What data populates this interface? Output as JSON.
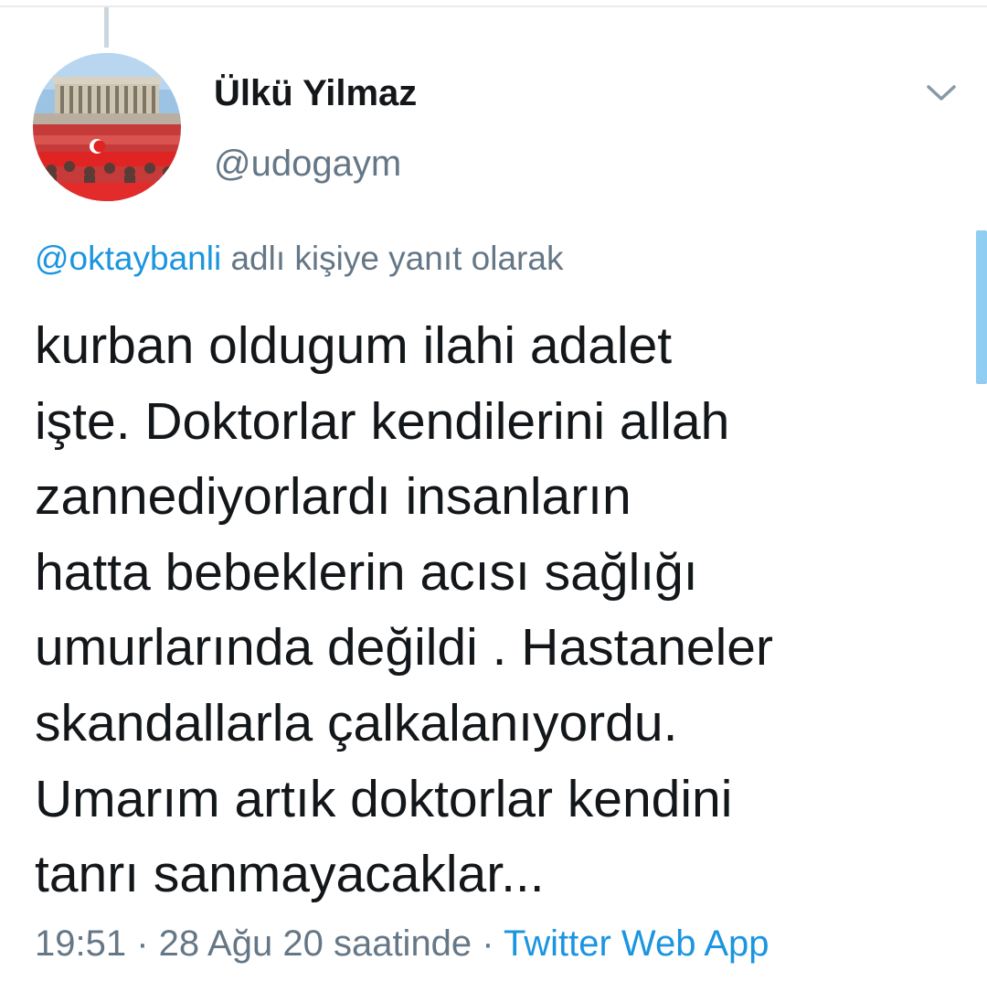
{
  "author": {
    "display_name": "Ülkü Yilmaz",
    "handle": "@udogaym"
  },
  "reply_context": {
    "mention": "@oktaybanli",
    "suffix": " adlı kişiye yanıt olarak"
  },
  "tweet": {
    "lines": [
      "kurban oldugum ilahi adalet",
      "işte. Doktorlar kendilerini allah",
      "zannediyorlardı insanların",
      "hatta bebeklerin acısı sağlığı",
      "umurlarında değildi . Hastaneler",
      "skandallarla çalkalanıyordu.",
      "Umarım artık doktorlar kendini",
      "tanrı sanmayacaklar..."
    ]
  },
  "meta": {
    "time": "19:51",
    "sep1": " · ",
    "date": "28 Ağu 20 saatinde",
    "sep2": " · ",
    "source": "Twitter Web App"
  },
  "icons": {
    "caret": "chevron-down-icon"
  },
  "colors": {
    "text_primary": "#14171a",
    "text_secondary": "#657786",
    "link": "#1b95e0",
    "divider": "#e6ecf0",
    "scrollbar": "#8fcdf3"
  }
}
